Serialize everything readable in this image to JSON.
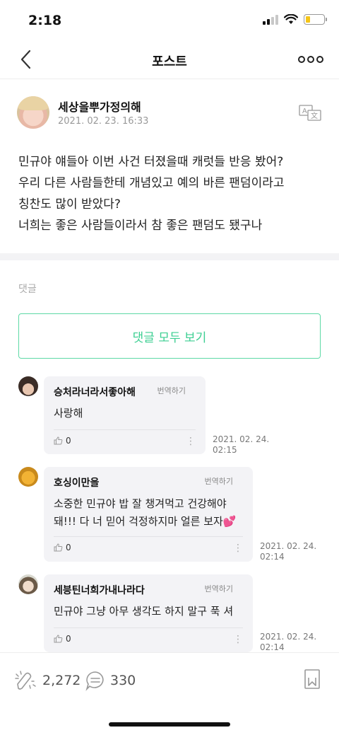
{
  "status_bar": {
    "time": "2:18"
  },
  "nav": {
    "title": "포스트"
  },
  "post": {
    "author": "세상을뿌가정의해",
    "date": "2021. 02. 23. 16:33",
    "body_lines": [
      "민규야 얘들아 이번 사건 터졌을때 캐럿들 반응 봤어?",
      "우리 다른 사람들한테 개념있고 예의 바른 팬덤이라고",
      "칭찬도 많이 받았다?",
      "너희는 좋은 사람들이라서 참 좋은 팬덤도 됐구나"
    ]
  },
  "comments_section": {
    "label": "댓글",
    "view_all": "댓글 모두 보기",
    "items": [
      {
        "author": "승처라너라서좋아해",
        "translate": "번역하기",
        "lines": [
          "사랑해"
        ],
        "likes": "0",
        "time_date": "2021. 02. 24.",
        "time_clock": "02:15"
      },
      {
        "author": "호싱이만을",
        "translate": "번역하기",
        "lines": [
          "소중한 민규야 밥 잘 챙겨먹고 건강해야",
          "돼!!! 다 너 믿어 걱정하지마 얼른 보자💕"
        ],
        "likes": "0",
        "time_date": "2021. 02. 24.",
        "time_clock": "02:14"
      },
      {
        "author": "세븡틴너희가내나라다",
        "translate": "번역하기",
        "lines": [
          "민규야 그냥 아무 생각도 하지 말구 푹 셔"
        ],
        "likes": "0",
        "time_date": "2021. 02. 24.",
        "time_clock": "02:14"
      }
    ]
  },
  "bottom_bar": {
    "likes": "2,272",
    "comments": "330"
  },
  "colors": {
    "accent": "#3ccf92",
    "battery": "#f5c518"
  }
}
